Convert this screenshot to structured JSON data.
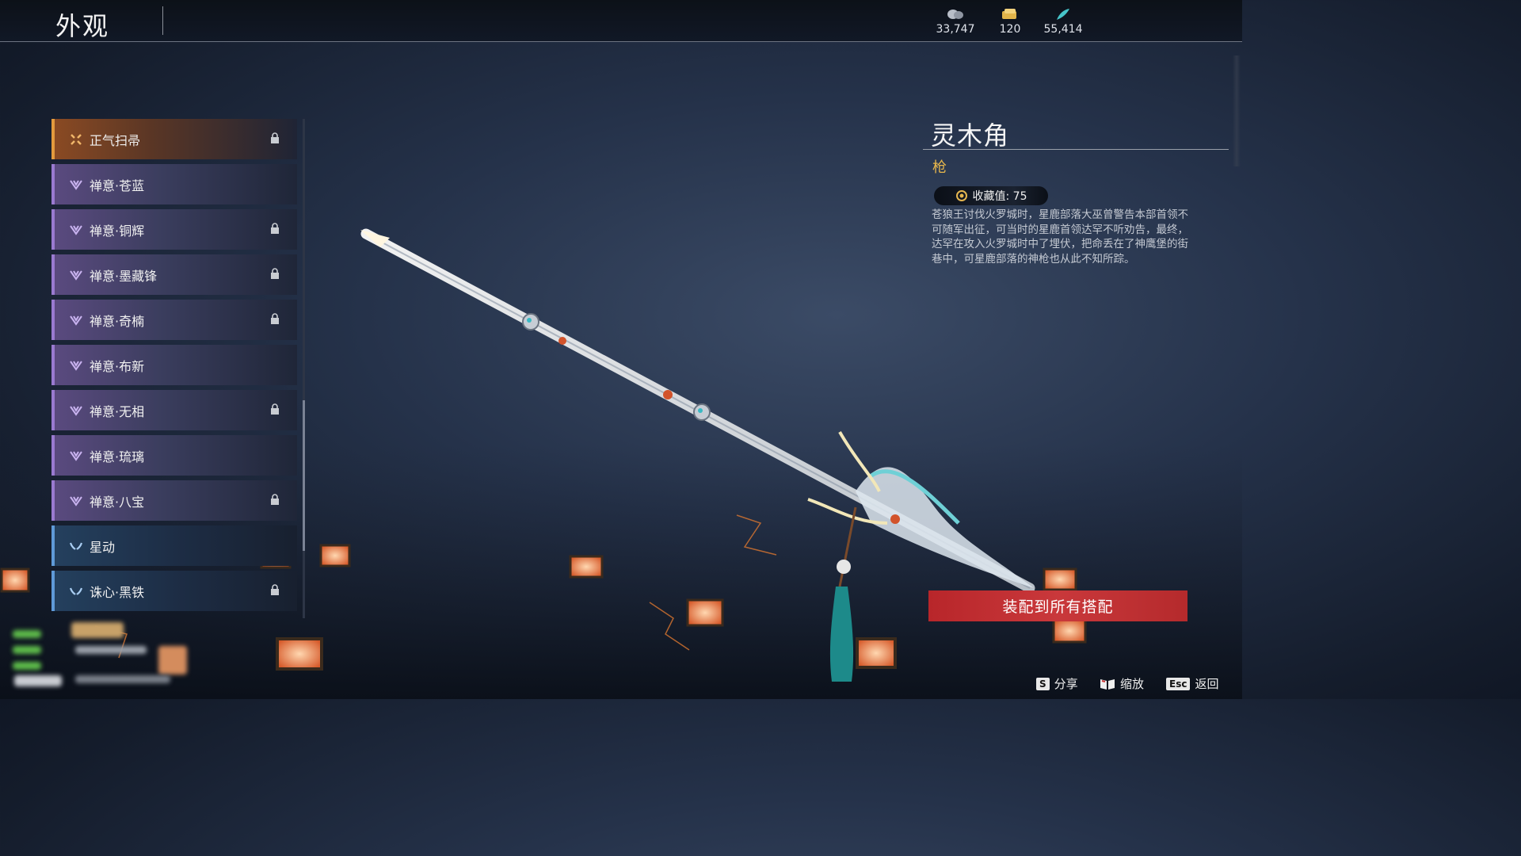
{
  "header": {
    "title": "外观"
  },
  "currencies": [
    {
      "icon": "silver-coin-icon",
      "value": "33,747"
    },
    {
      "icon": "gold-ticket-icon",
      "value": "120"
    },
    {
      "icon": "jade-feather-icon",
      "value": "55,414"
    }
  ],
  "list": {
    "items": [
      {
        "label": "正气扫帚",
        "icon": "special-burst-icon",
        "locked": true,
        "style": "special"
      },
      {
        "label": "禅意·苍蓝",
        "icon": "zen-lotus-icon",
        "locked": false,
        "style": "purple"
      },
      {
        "label": "禅意·铜辉",
        "icon": "zen-lotus-icon",
        "locked": true,
        "style": "purple"
      },
      {
        "label": "禅意·墨藏锋",
        "icon": "zen-lotus-icon",
        "locked": true,
        "style": "purple"
      },
      {
        "label": "禅意·奇楠",
        "icon": "zen-lotus-icon",
        "locked": true,
        "style": "purple"
      },
      {
        "label": "禅意·布新",
        "icon": "zen-lotus-icon",
        "locked": false,
        "style": "purple"
      },
      {
        "label": "禅意·无相",
        "icon": "zen-lotus-icon",
        "locked": true,
        "style": "purple"
      },
      {
        "label": "禅意·琉璃",
        "icon": "zen-lotus-icon",
        "locked": false,
        "style": "purple"
      },
      {
        "label": "禅意·八宝",
        "icon": "zen-lotus-icon",
        "locked": true,
        "style": "purple"
      },
      {
        "label": "星动",
        "icon": "star-wing-icon",
        "locked": false,
        "style": "blue"
      },
      {
        "label": "诛心·黑铁",
        "icon": "star-wing-icon",
        "locked": true,
        "style": "blue"
      }
    ]
  },
  "detail": {
    "name": "灵木角",
    "type": "枪",
    "collection_label": "收藏值: 75",
    "description": "苍狼王讨伐火罗城时，星鹿部落大巫曾警告本部首领不可随军出征，可当时的星鹿首领达罕不听劝告，最终，达罕在攻入火罗城时中了埋伏，把命丢在了神鹰堡的街巷中，可星鹿部落的神枪也从此不知所踪。"
  },
  "equip_button": "装配到所有搭配",
  "hints": [
    {
      "key": "S",
      "label": "分享"
    },
    {
      "key": "book-icon",
      "label": "缩放"
    },
    {
      "key": "Esc",
      "label": "返回"
    }
  ],
  "colors": {
    "accent_red": "#c32f32",
    "type_gold": "#e8b74c",
    "purple_border": "#9a7ad0"
  }
}
